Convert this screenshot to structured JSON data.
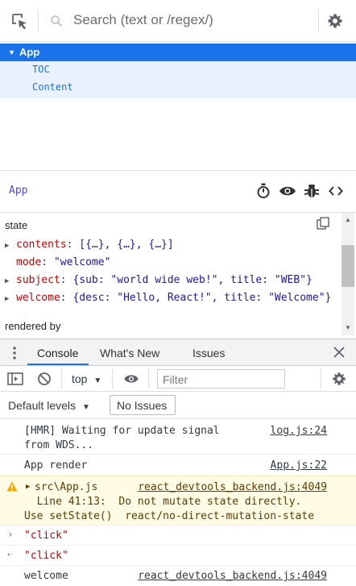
{
  "tree_toolbar": {
    "search_placeholder": "Search (text or /regex/)",
    "icons": [
      "select-element-icon",
      "search-icon",
      "settings-gear-icon"
    ]
  },
  "tree": {
    "root": {
      "label": "App",
      "expanded": true
    },
    "children": [
      "TOC",
      "Content"
    ]
  },
  "inspect": {
    "component_name": "App",
    "icons": [
      "stopwatch-icon",
      "eye-icon",
      "bug-icon",
      "code-icon"
    ]
  },
  "props": {
    "section_label": "state",
    "items": [
      {
        "key": "contents",
        "value": "[{…}, {…}, {…}]",
        "expandable": true
      },
      {
        "key": "mode",
        "value": "\"welcome\"",
        "expandable": false
      },
      {
        "key": "subject",
        "value": "{sub: \"world wide web!\", title: \"WEB\"}",
        "expandable": true
      },
      {
        "key": "welcome",
        "value": "{desc: \"Hello, React!\", title: \"Welcome\"}",
        "expandable": true
      }
    ],
    "rendered_by": "rendered by"
  },
  "drawer": {
    "tabs": [
      "Console",
      "What's New",
      "Issues"
    ],
    "active_tab": "Console"
  },
  "console_toolbar": {
    "context": "top",
    "filter_placeholder": "Filter",
    "default_levels": "Default levels",
    "no_issues": "No Issues"
  },
  "messages": [
    {
      "text_line1": "[HMR] Waiting for update signal",
      "text_line2": "from WDS...",
      "source": "log.js:24"
    },
    {
      "text": "App render",
      "source": "App.js:22"
    },
    {
      "line1": "src\\App.js",
      "line1_source": "react_devtools_backend.js:4049",
      "line2": "  Line 41:13:  Do not mutate state directly.",
      "line3": "Use setState()  react/no-direct-mutation-state"
    },
    {
      "text": "\"click\""
    },
    {
      "text": "\"click\""
    },
    {
      "text": "welcome",
      "source": "react_devtools_backend.js:4049"
    }
  ]
}
